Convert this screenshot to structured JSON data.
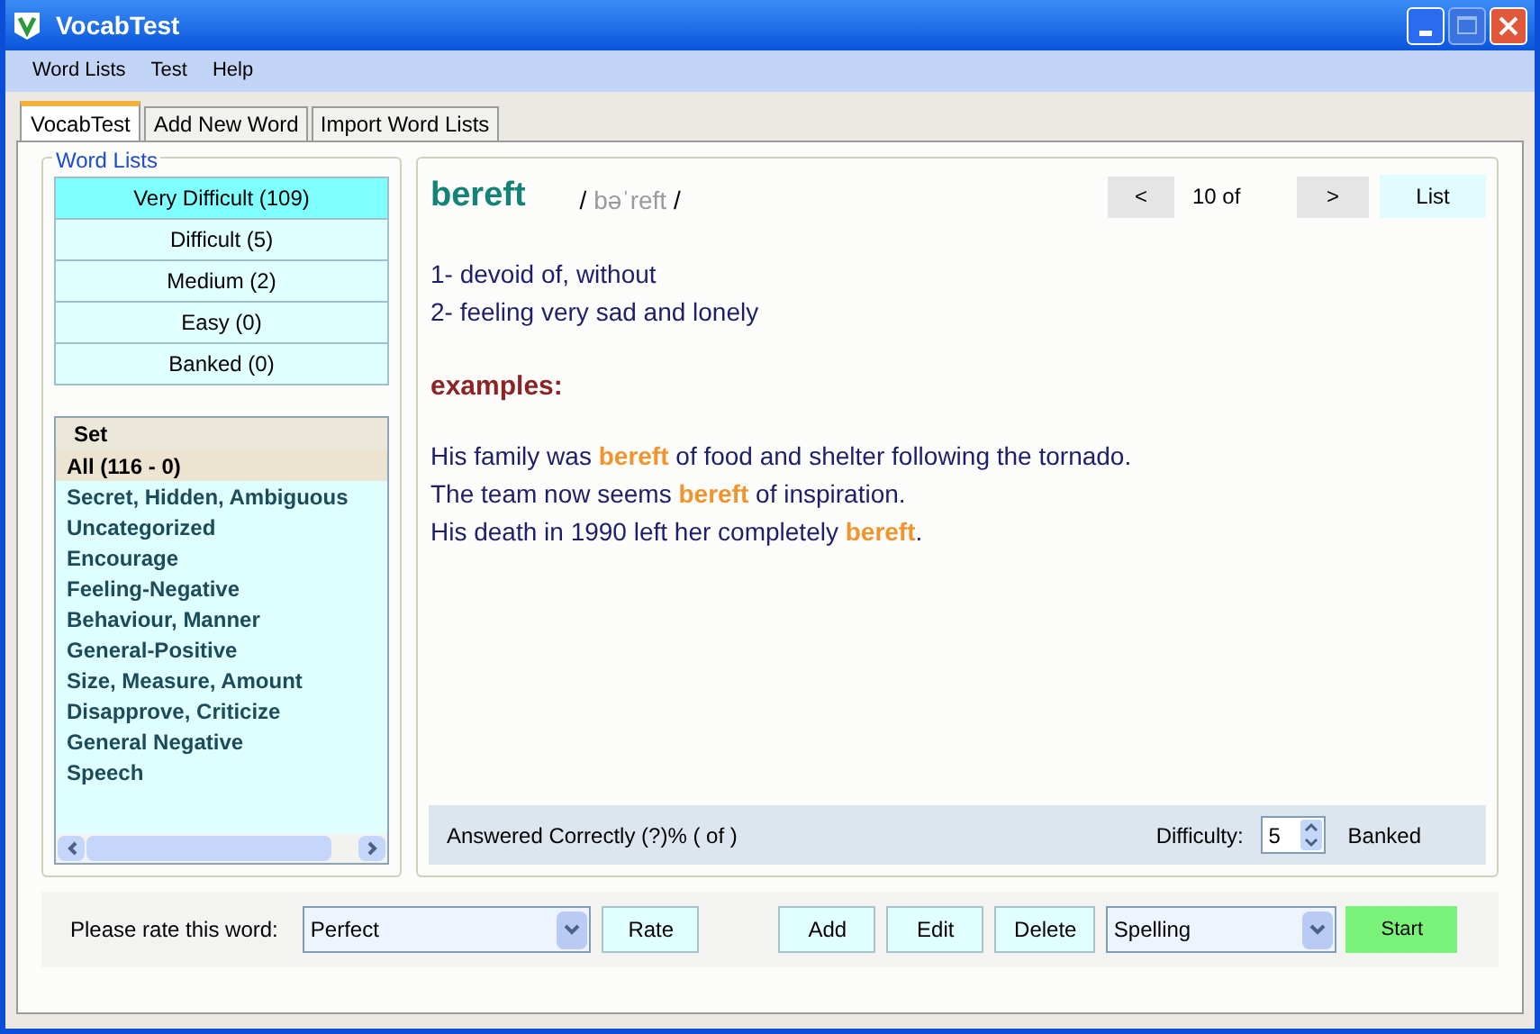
{
  "window": {
    "title": "VocabTest"
  },
  "menu": [
    "Word Lists",
    "Test",
    "Help"
  ],
  "tabs": [
    {
      "label": "VocabTest",
      "selected": true
    },
    {
      "label": "Add New Word",
      "selected": false
    },
    {
      "label": "Import Word Lists",
      "selected": false
    }
  ],
  "word_lists": {
    "title": "Word Lists",
    "items": [
      {
        "label": "Very Difficult (109)",
        "selected": true
      },
      {
        "label": "Difficult (5)",
        "selected": false
      },
      {
        "label": "Medium (2)",
        "selected": false
      },
      {
        "label": "Easy (0)",
        "selected": false
      },
      {
        "label": "Banked (0)",
        "selected": false
      }
    ]
  },
  "sets": {
    "header": "Set",
    "items": [
      {
        "label": "All (116 - 0)",
        "selected": true
      },
      {
        "label": "Secret, Hidden, Ambiguous",
        "selected": false
      },
      {
        "label": "Uncategorized",
        "selected": false
      },
      {
        "label": "Encourage",
        "selected": false
      },
      {
        "label": "Feeling-Negative",
        "selected": false
      },
      {
        "label": "Behaviour, Manner",
        "selected": false
      },
      {
        "label": "General-Positive",
        "selected": false
      },
      {
        "label": "Size, Measure, Amount",
        "selected": false
      },
      {
        "label": "Disapprove, Criticize",
        "selected": false
      },
      {
        "label": "General Negative",
        "selected": false
      },
      {
        "label": "Speech",
        "selected": false
      }
    ]
  },
  "word": {
    "term": "bereft",
    "pron_open": "/",
    "pronunciation": "bəˈreft",
    "pron_close": "/",
    "prev": "<",
    "position": "10 of",
    "next": ">",
    "list_button": "List",
    "definitions": [
      "1- devoid of, without",
      "2- feeling very sad and lonely"
    ],
    "examples_label": "examples:",
    "examples": [
      {
        "parts": [
          {
            "text": "His family was ",
            "highlight": false
          },
          {
            "text": "bereft",
            "highlight": true
          },
          {
            "text": " of food and shelter following the tornado.",
            "highlight": false
          }
        ]
      },
      {
        "parts": [
          {
            "text": "The team now seems ",
            "highlight": false
          },
          {
            "text": "bereft",
            "highlight": true
          },
          {
            "text": " of inspiration.",
            "highlight": false
          }
        ]
      },
      {
        "parts": [
          {
            "text": "His death in 1990 left her completely ",
            "highlight": false
          },
          {
            "text": "bereft",
            "highlight": true
          },
          {
            "text": ".",
            "highlight": false
          }
        ]
      }
    ],
    "status": "Answered Correctly (?)% ( of )",
    "difficulty_label": "Difficulty:",
    "difficulty": "5",
    "banked": "Banked"
  },
  "bottom": {
    "rate_label": "Please rate this word:",
    "rating": "Perfect",
    "rate": "Rate",
    "add": "Add",
    "edit": "Edit",
    "delete": "Delete",
    "mode": "Spelling",
    "start": "Start"
  }
}
